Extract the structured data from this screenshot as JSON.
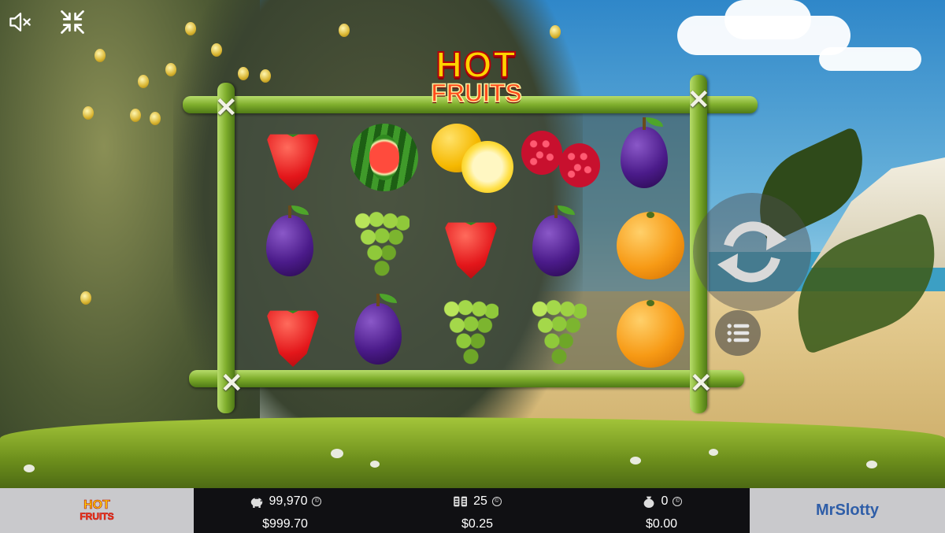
{
  "game": {
    "title_hot": "HOT",
    "title_fruits": "FRUITS"
  },
  "controls": {
    "sound_icon": "speaker-muted-icon",
    "fullscreen_icon": "collapse-arrows-icon",
    "spin_icon": "circular-arrows-icon",
    "menu_icon": "hamburger-icon"
  },
  "reels": {
    "rows": [
      [
        "strawberry",
        "watermelon",
        "lemon",
        "raspberry",
        "plum"
      ],
      [
        "plum",
        "grapes",
        "strawberry",
        "plum",
        "orange"
      ],
      [
        "strawberry",
        "plum",
        "grapes",
        "grapes",
        "orange"
      ]
    ]
  },
  "bottom_bar": {
    "balance_coins": "99,970",
    "balance_money": "$999.70",
    "bet_coins": "25",
    "bet_money": "$0.25",
    "win_coins": "0",
    "win_money": "$0.00",
    "coin_symbol": "©",
    "brand": "MrSlotty",
    "mini_logo_hot": "HOT",
    "mini_logo_fruits": "FRUITS"
  },
  "colors": {
    "bar_bg": "#101013",
    "side_panels": "#c9c9cc",
    "brand_blue": "#2f5ea8",
    "bamboo": "#7fae2c"
  }
}
